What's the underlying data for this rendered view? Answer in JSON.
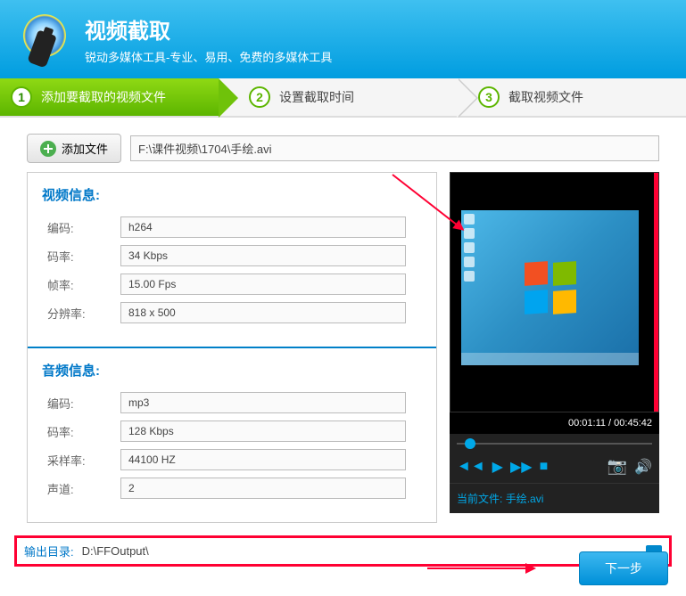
{
  "header": {
    "title": "视频截取",
    "subtitle": "锐动多媒体工具-专业、易用、免费的多媒体工具"
  },
  "steps": {
    "s1": {
      "num": "1",
      "label": "添加要截取的视频文件"
    },
    "s2": {
      "num": "2",
      "label": "设置截取时间"
    },
    "s3": {
      "num": "3",
      "label": "截取视频文件"
    }
  },
  "toolbar": {
    "add_label": "添加文件",
    "file_path": "F:\\课件视频\\1704\\手绘.avi"
  },
  "video_info": {
    "title": "视频信息:",
    "codec_label": "编码:",
    "codec_value": "h264",
    "bitrate_label": "码率:",
    "bitrate_value": "34 Kbps",
    "fps_label": "帧率:",
    "fps_value": "15.00 Fps",
    "res_label": "分辨率:",
    "res_value": "818 x 500"
  },
  "audio_info": {
    "title": "音频信息:",
    "codec_label": "编码:",
    "codec_value": "mp3",
    "bitrate_label": "码率:",
    "bitrate_value": "128 Kbps",
    "sample_label": "采样率:",
    "sample_value": "44100 HZ",
    "channel_label": "声道:",
    "channel_value": "2"
  },
  "player": {
    "time": "00:01:11 / 00:45:42",
    "current_file_label": "当前文件:",
    "current_file": "手绘.avi"
  },
  "output": {
    "label": "输出目录:",
    "path": "D:\\FFOutput\\"
  },
  "footer": {
    "next_label": "下一步"
  }
}
